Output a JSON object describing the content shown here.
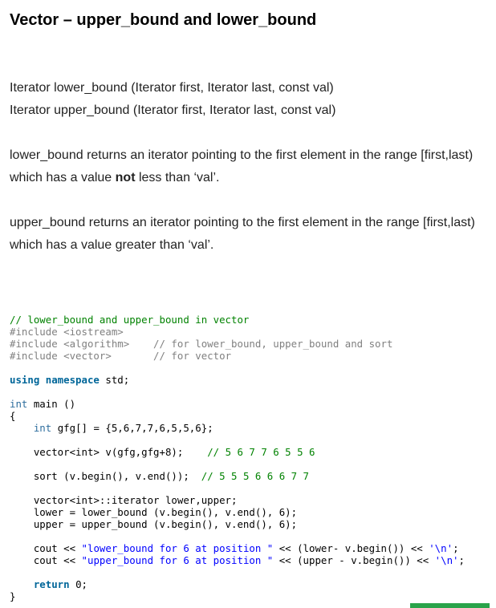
{
  "title": "Vector – upper_bound and lower_bound",
  "signatures": [
    "Iterator lower_bound (Iterator first, Iterator last, const val)",
    "Iterator upper_bound (Iterator first, Iterator last, const val)"
  ],
  "lower_desc": {
    "line1": "lower_bound returns an iterator pointing to the first element in the range [first,last)",
    "line2_pre": "which has a value ",
    "line2_bold": "not",
    "line2_post": " less than ‘val’."
  },
  "upper_desc": {
    "line1": "upper_bound returns an iterator pointing to the first element in the range [first,last)",
    "line2": "which has a value greater than ‘val’."
  },
  "code": {
    "l1_comment": "// lower_bound and upper_bound in vector",
    "l2_include": "#include <iostream>",
    "l3_include": "#include <algorithm>",
    "l3_comment": "// for lower_bound, upper_bound and sort",
    "l4_include": "#include <vector>",
    "l4_comment": "// for vector",
    "l6_kw": "using namespace",
    "l6_rest": " std;",
    "l8_type": "int",
    "l8_rest": " main ()",
    "l9": "{",
    "l10_type": "int",
    "l10_rest": " gfg[] = {5,6,7,7,6,5,5,6};",
    "l12_code": "vector<int> v(gfg,gfg+8);",
    "l12_comment": "// 5 6 7 7 6 5 5 6",
    "l14_code": "sort (v.begin(), v.end());",
    "l14_comment": "// 5 5 5 6 6 6 7 7",
    "l16": "vector<int>::iterator lower,upper;",
    "l17": "lower = lower_bound (v.begin(), v.end(), 6);",
    "l18": "upper = upper_bound (v.begin(), v.end(), 6);",
    "l20_pre": "cout << ",
    "l20_str": "\"lower_bound for 6 at position \"",
    "l20_mid": " << (lower- v.begin()) << ",
    "l20_chr": "'\\n'",
    "l20_end": ";",
    "l21_pre": "cout << ",
    "l21_str": "\"upper_bound for 6 at position \"",
    "l21_mid": " << (upper - v.begin()) << ",
    "l21_chr": "'\\n'",
    "l21_end": ";",
    "l23_kw": "return",
    "l23_rest": " 0;",
    "l24": "}"
  }
}
